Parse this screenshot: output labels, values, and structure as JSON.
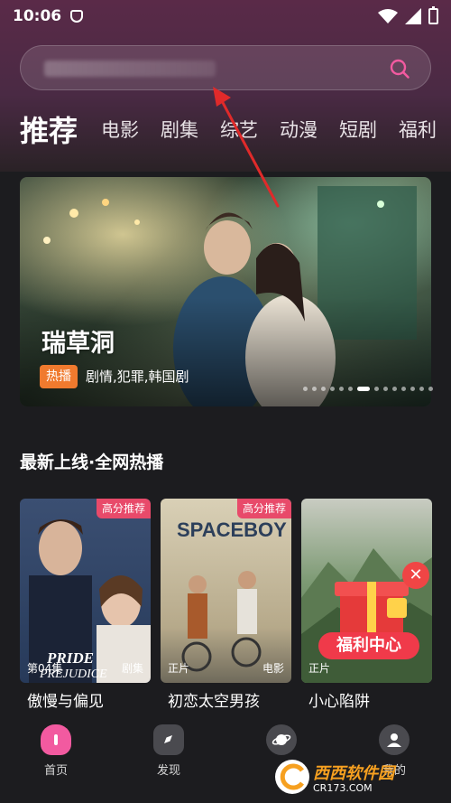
{
  "status_bar": {
    "time": "10:06"
  },
  "search": {
    "placeholder": ""
  },
  "tabs": [
    {
      "label": "推荐",
      "active": true
    },
    {
      "label": "电影"
    },
    {
      "label": "剧集"
    },
    {
      "label": "综艺"
    },
    {
      "label": "动漫"
    },
    {
      "label": "短剧"
    },
    {
      "label": "福利"
    }
  ],
  "banner": {
    "title": "瑞草洞",
    "badge": "热播",
    "genres": "剧情,犯罪,韩国剧",
    "slide_count": 14,
    "active_slide": 6
  },
  "section": {
    "title": "最新上线·全网热播"
  },
  "cards": [
    {
      "tag": "高分推荐",
      "left_label": "第04集",
      "right_label": "剧集",
      "title": "傲慢与偏见",
      "poster_text": "PRIDE PREJUDICE"
    },
    {
      "tag": "高分推荐",
      "left_label": "正片",
      "right_label": "电影",
      "title": "初恋太空男孩",
      "poster_text": "SPACEBOY"
    },
    {
      "tag": "",
      "left_label": "正片",
      "right_label": "",
      "title": "小心陷阱",
      "poster_text": ""
    }
  ],
  "popup": {
    "label": "福利中心"
  },
  "bottom_nav": [
    {
      "label": "首页",
      "icon": "home-icon",
      "active": true
    },
    {
      "label": "发现",
      "icon": "compass-icon"
    },
    {
      "label": "",
      "icon": "planet-icon"
    },
    {
      "label": "我的",
      "icon": "user-icon"
    }
  ],
  "watermark": {
    "name": "西西软件园",
    "url": "CR173.COM"
  },
  "colors": {
    "accent": "#f25aa0",
    "badge": "#f07a2e",
    "tag": "#e84a6a"
  }
}
